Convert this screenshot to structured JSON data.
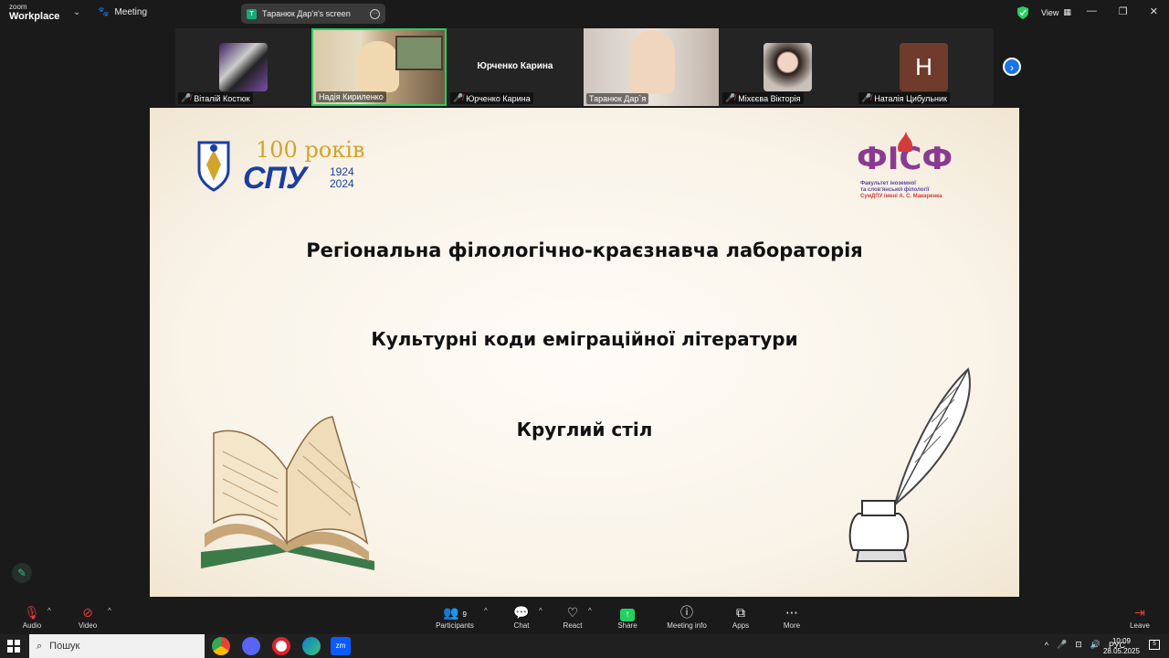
{
  "app": {
    "logo_top": "zoom",
    "logo_bottom": "Workplace",
    "meeting_label": "Meeting",
    "screen_share_label": "Таранюк Дар'я's screen",
    "view_label": "View"
  },
  "participants": [
    {
      "name": "Віталій Костюк",
      "muted": true
    },
    {
      "name": "Надія Кириленко",
      "muted": false,
      "active": true
    },
    {
      "name": "Юрченко Карина",
      "muted": true,
      "display": "Юрченко Карина"
    },
    {
      "name": "Таранюк Дар`я",
      "muted": false
    },
    {
      "name": "Міхєєва Вікторія",
      "muted": true
    },
    {
      "name": "Наталія Цибульник",
      "muted": true,
      "initial": "Н"
    }
  ],
  "slide": {
    "logo_left_text": "100 років",
    "logo_left_abbr": "СПУ",
    "logo_left_years": "1924 2024",
    "logo_right_abbr": "ФІСФ",
    "logo_right_caption1": "Факультет іноземної",
    "logo_right_caption2": "та слов'янської філології",
    "logo_right_caption3": "СумДПУ імені А. С. Макаренка",
    "title1": "Регіональна  філологічно-краєзнавча лабораторія",
    "title2": "Культурні коди еміграційної літератури",
    "title3": "Круглий стіл"
  },
  "toolbar": {
    "audio": "Audio",
    "video": "Video",
    "participants": "Participants",
    "participants_count": "9",
    "chat": "Chat",
    "react": "React",
    "share": "Share",
    "meeting_info": "Meeting info",
    "apps": "Apps",
    "more": "More",
    "leave": "Leave"
  },
  "taskbar": {
    "search_placeholder": "Пошук",
    "lang": "РУС",
    "time": "10:09",
    "date": "28.05.2025",
    "notif_count": "5"
  },
  "colors": {
    "accent_blue": "#1a73e8",
    "share_green": "#23d160",
    "muted_red": "#e23b3b",
    "spu_blue": "#1b3fa0",
    "spu_gold": "#d4a32a"
  }
}
